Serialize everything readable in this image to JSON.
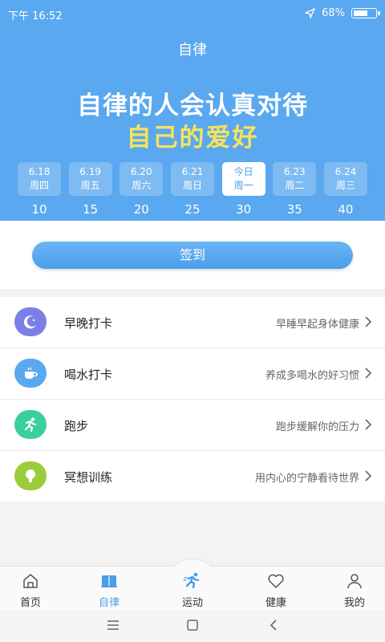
{
  "status": {
    "time": "下午 16:52",
    "battery": "68%",
    "battery_level": 0.68
  },
  "header": {
    "title": "自律",
    "slogan_line1": "自律的人会认真对待",
    "slogan_line2": "自己的爱好"
  },
  "days": [
    {
      "date": "6.18",
      "weekday": "周四",
      "points": "10",
      "today": false
    },
    {
      "date": "6.19",
      "weekday": "周五",
      "points": "15",
      "today": false
    },
    {
      "date": "6.20",
      "weekday": "周六",
      "points": "20",
      "today": false
    },
    {
      "date": "6.21",
      "weekday": "周日",
      "points": "25",
      "today": false
    },
    {
      "date": "今日",
      "weekday": "周一",
      "points": "30",
      "today": true
    },
    {
      "date": "6.23",
      "weekday": "周二",
      "points": "35",
      "today": false
    },
    {
      "date": "6.24",
      "weekday": "周三",
      "points": "40",
      "today": false
    }
  ],
  "signin": {
    "label": "签到"
  },
  "activities": [
    {
      "name": "早晚打卡",
      "desc": "早睡早起身体健康",
      "icon": "moon-icon",
      "color": "#7b7fe8"
    },
    {
      "name": "喝水打卡",
      "desc": "养成多喝水的好习惯",
      "icon": "cup-icon",
      "color": "#5aa8ef"
    },
    {
      "name": "跑步",
      "desc": "跑步缓解你的压力",
      "icon": "runner-icon",
      "color": "#3ccf9e"
    },
    {
      "name": "冥想训练",
      "desc": "用内心的宁静看待世界",
      "icon": "bulb-icon",
      "color": "#9ccb3c"
    }
  ],
  "tabs": {
    "home": "首页",
    "discipline": "自律",
    "sport": "运动",
    "health": "健康",
    "mine": "我的"
  },
  "colors": {
    "primary": "#5aa8ef",
    "accent": "#4a9ee9",
    "slogan_yellow": "#f7e35a"
  }
}
